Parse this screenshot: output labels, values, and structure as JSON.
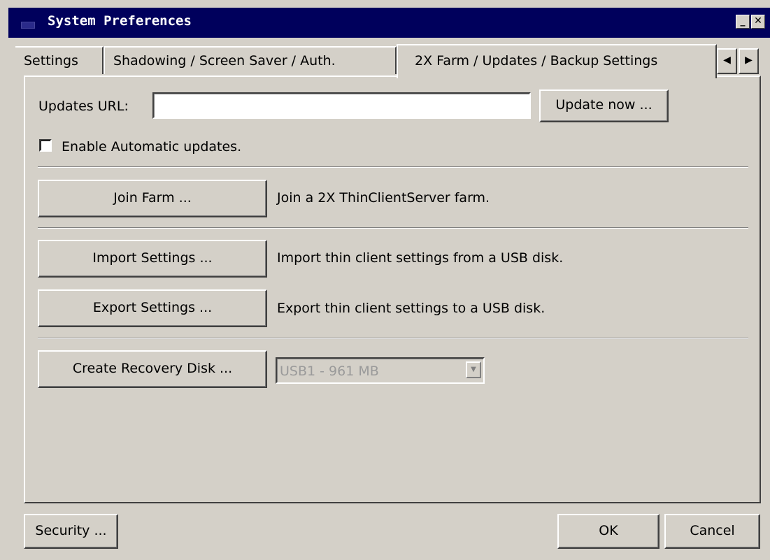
{
  "window": {
    "title": "System Preferences",
    "minimize_icon": "minimize-icon",
    "close_icon": "close-icon"
  },
  "tabs": [
    {
      "label": "Settings"
    },
    {
      "label": "Shadowing / Screen Saver / Auth."
    },
    {
      "label": "2X Farm / Updates /  Backup Settings",
      "active": true
    }
  ],
  "tab_scroll": {
    "left_icon": "triangle-left-icon",
    "right_icon": "triangle-right-icon"
  },
  "updates": {
    "url_label": "Updates URL:",
    "url_value": "",
    "update_now_label": "Update now ...",
    "auto_updates_label": "Enable Automatic updates.",
    "auto_updates_checked": false
  },
  "farm": {
    "join_label": "Join Farm ...",
    "join_desc": "Join a 2X ThinClientServer farm."
  },
  "settings_io": {
    "import_label": "Import Settings ...",
    "import_desc": "Import thin client settings from a USB disk.",
    "export_label": "Export Settings ...",
    "export_desc": "Export thin client settings to a USB disk."
  },
  "recovery": {
    "create_label": "Create Recovery Disk ...",
    "disk_selected": "USB1 - 961 MB",
    "disk_enabled": false
  },
  "footer": {
    "security_label": "Security ...",
    "ok_label": "OK",
    "cancel_label": "Cancel"
  }
}
